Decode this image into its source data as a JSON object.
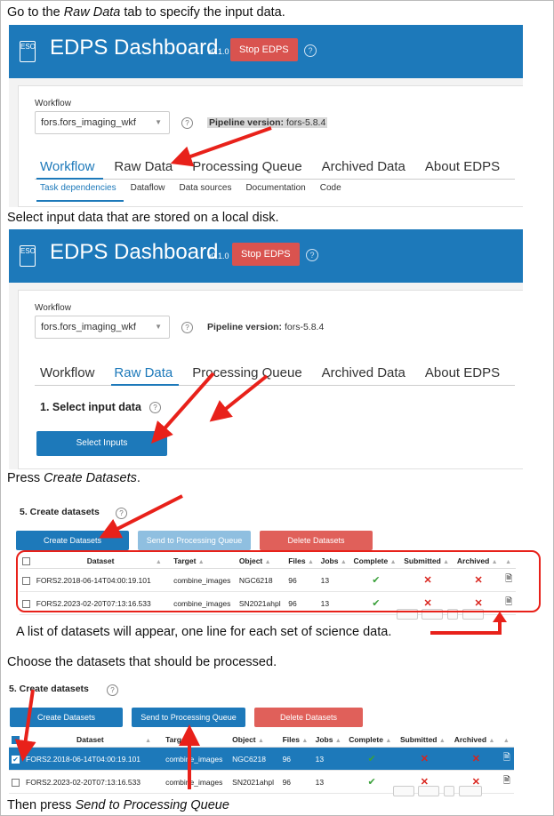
{
  "captions": {
    "c1_pre": "Go to the ",
    "c1_em": "Raw Data",
    "c1_post": " tab to specify the input data.",
    "c2": "Select input data that are stored on a local disk.",
    "c3_pre": "Press ",
    "c3_em": "Create Datasets",
    "c3_post": ".",
    "c4": "A list of datasets will appear, one line for each set of science data.",
    "c5": "Choose the datasets that should be processed.",
    "c6_pre": "Then press ",
    "c6_em": "Send to Processing Queue"
  },
  "dashboard": {
    "title": "EDPS Dashboard",
    "version": "v0.1.0",
    "stop_button": "Stop EDPS",
    "help": "?",
    "logo_text": "ESO"
  },
  "workflow": {
    "label": "Workflow",
    "selected": "fors.fors_imaging_wkf",
    "pipeline_label": "Pipeline version:",
    "pipeline_value": "fors-5.8.4"
  },
  "tabs": [
    "Workflow",
    "Raw Data",
    "Processing Queue",
    "Archived Data",
    "About EDPS"
  ],
  "subtabs": [
    "Task dependencies",
    "Dataflow",
    "Data sources",
    "Documentation",
    "Code"
  ],
  "raw_data": {
    "section_title": "1. Select input data",
    "select_button": "Select Inputs"
  },
  "datasets": {
    "section_title": "5. Create datasets",
    "create_button": "Create Datasets",
    "send_button": "Send to Processing Queue",
    "delete_button": "Delete Datasets",
    "columns": [
      "Dataset",
      "Target",
      "Object",
      "Files",
      "Jobs",
      "Complete",
      "Submitted",
      "Archived"
    ],
    "rows": [
      {
        "dataset": "FORS2.2018-06-14T04:00:19.101",
        "target": "combine_images",
        "object": "NGC6218",
        "files": "96",
        "jobs": "13"
      },
      {
        "dataset": "FORS2.2023-02-20T07:13:16.533",
        "target": "combine_images",
        "object": "SN2021ahpl",
        "files": "96",
        "jobs": "13"
      }
    ]
  },
  "colors": {
    "header_blue": "#1d79ba",
    "stop_red": "#d9534f",
    "arrow_red": "#e8211a"
  }
}
